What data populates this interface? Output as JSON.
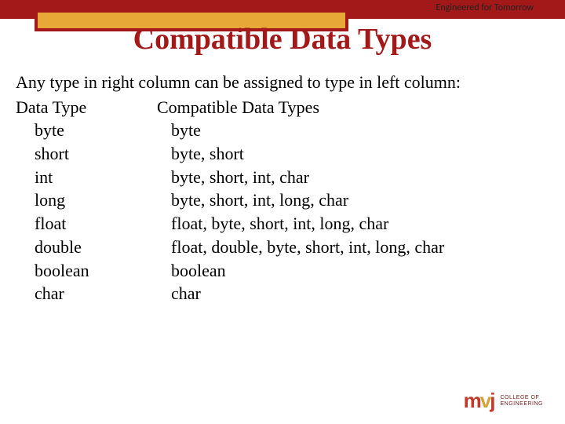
{
  "header": {
    "tagline": "Engineered for Tomorrow",
    "title": "Compatible Data Types"
  },
  "content": {
    "intro": "Any type in right column can be assigned to type in left column:",
    "col_left_header": "Data Type",
    "col_right_header": "Compatible Data Types",
    "rows": [
      {
        "left": "byte",
        "right": "byte"
      },
      {
        "left": "short",
        "right": "byte, short"
      },
      {
        "left": "int",
        "right": "byte, short, int, char"
      },
      {
        "left": "long",
        "right": "byte, short, int, long, char"
      },
      {
        "left": "float",
        "right": "float, byte, short, int, long, char"
      },
      {
        "left": "double",
        "right": "float, double, byte, short, int, long, char"
      },
      {
        "left": "boolean",
        "right": "boolean"
      },
      {
        "left": "char",
        "right": "char"
      }
    ]
  },
  "logo": {
    "m": "m",
    "v": "v",
    "j": "j",
    "line1": "COLLEGE OF",
    "line2": "ENGINEERING"
  }
}
